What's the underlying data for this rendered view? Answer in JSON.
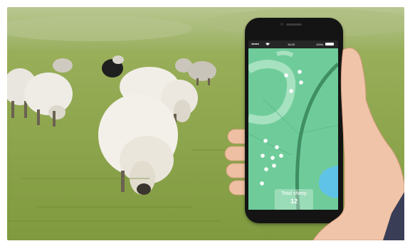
{
  "colors": {
    "grass": "#8fa855",
    "map_green": "#6fcc9a",
    "map_dark_green": "#3f8e64",
    "water": "#5fc3e8",
    "phone_body": "#141414",
    "skin": "#f0c4a8"
  },
  "phone": {
    "status_bar": {
      "signal": "●●●●●",
      "wifi_icon": "wifi-icon",
      "time": "16:20",
      "battery_percent": "100%"
    },
    "total_label": "Total sheep",
    "total_count": "12"
  }
}
